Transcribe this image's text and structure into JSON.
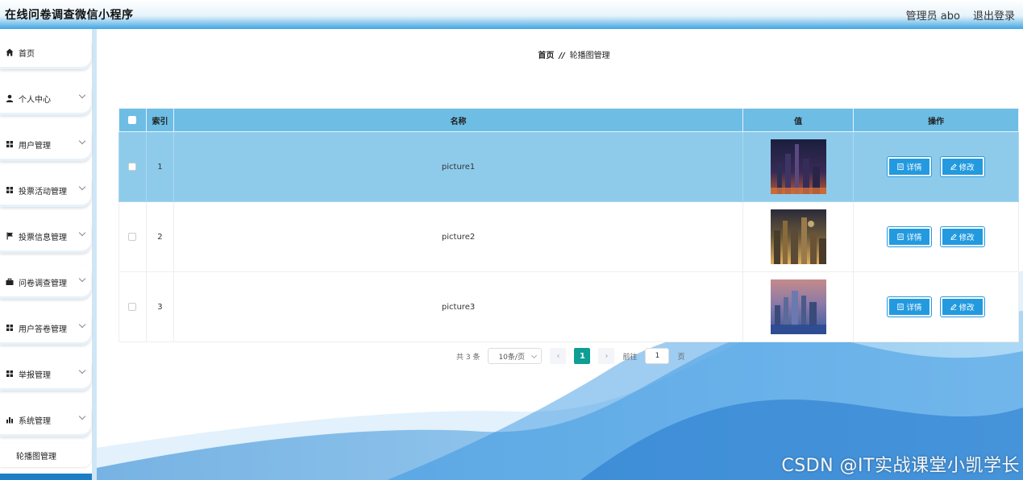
{
  "header": {
    "title": "在线问卷调查微信小程序",
    "user_label": "管理员 abo",
    "logout_label": "退出登录"
  },
  "sidebar": {
    "items": [
      {
        "label": "首页",
        "icon": "home-icon"
      },
      {
        "label": "个人中心",
        "icon": "user-icon"
      },
      {
        "label": "用户管理",
        "icon": "grid-icon"
      },
      {
        "label": "投票活动管理",
        "icon": "grid-icon"
      },
      {
        "label": "投票信息管理",
        "icon": "flag-icon"
      },
      {
        "label": "问卷调查管理",
        "icon": "briefcase-icon"
      },
      {
        "label": "用户答卷管理",
        "icon": "grid-icon"
      },
      {
        "label": "举报管理",
        "icon": "grid-icon"
      },
      {
        "label": "系统管理",
        "icon": "bar-chart-icon"
      }
    ],
    "submenu": {
      "label": "轮播图管理"
    }
  },
  "breadcrumb": {
    "home": "首页",
    "separator": "//",
    "current": "轮播图管理"
  },
  "table": {
    "columns": {
      "index": "索引",
      "name": "名称",
      "value": "值",
      "actions": "操作"
    },
    "rows": [
      {
        "index": "1",
        "name": "picture1",
        "selected": true
      },
      {
        "index": "2",
        "name": "picture2",
        "selected": false
      },
      {
        "index": "3",
        "name": "picture3",
        "selected": false
      }
    ],
    "detail_label": "详情",
    "edit_label": "修改"
  },
  "pagination": {
    "total": "共 3 条",
    "page_size": "10条/页",
    "prev": "‹",
    "current": "1",
    "next": "›",
    "goto_label": "前往",
    "goto_value": "1",
    "page_suffix": "页"
  },
  "watermark": "CSDN @IT实战课堂小凯学长",
  "colors": {
    "header_accent": "#3fa6e3",
    "table_header": "#6dbde5",
    "row_selected": "#8ecbeb",
    "button": "#239ae0",
    "pager_current": "#0e9e94"
  }
}
